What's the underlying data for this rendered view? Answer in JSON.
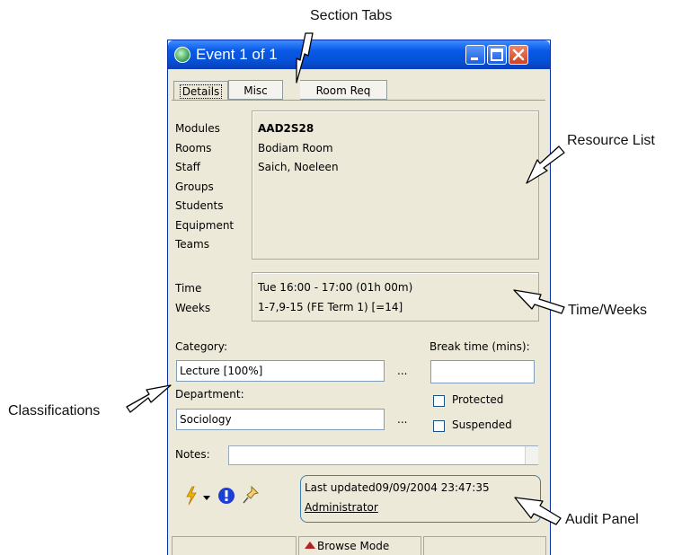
{
  "callouts": {
    "section_tabs": "Section Tabs",
    "resource_list": "Resource List",
    "time_weeks": "Time/Weeks",
    "classifications": "Classifications",
    "audit_panel": "Audit Panel"
  },
  "window": {
    "title": "Event  1 of 1",
    "tabs": [
      "Details",
      "Misc",
      "Room Req"
    ],
    "active_tab": "Details"
  },
  "resources": {
    "labels": [
      "Modules",
      "Rooms",
      "Staff",
      "Groups",
      "Students",
      "Equipment",
      "Teams"
    ],
    "module": "AAD2S28",
    "room": "Bodiam Room",
    "staff": "Saich, Noeleen"
  },
  "timing": {
    "time_label": "Time",
    "weeks_label": "Weeks",
    "time_value": "Tue 16:00 - 17:00 (01h 00m)",
    "weeks_value": "1-7,9-15 (FE Term 1) [=14]"
  },
  "classification": {
    "category_label": "Category:",
    "category_value": "Lecture [100%]",
    "department_label": "Department:",
    "department_value": "Sociology",
    "ellipsis": "...",
    "break_time_label": "Break time (mins):",
    "break_time_value": "",
    "protected_label": "Protected",
    "suspended_label": "Suspended",
    "protected_checked": false,
    "suspended_checked": false
  },
  "notes": {
    "label": "Notes:",
    "value": ""
  },
  "audit": {
    "last_updated_text": "Last updated09/09/2004 23:47:35",
    "user": "Administrator"
  },
  "toolbar_icons": [
    "lightning-icon",
    "dropdown-arrow-icon",
    "info-icon",
    "pin-icon"
  ],
  "status_bar": {
    "mode": "Browse Mode"
  },
  "colors": {
    "titlebar": "#0552d8",
    "window_bg": "#ece9d8",
    "audit_border": "#3c7fb1",
    "lightning": "#f0b400",
    "info": "#1d3fd6"
  }
}
